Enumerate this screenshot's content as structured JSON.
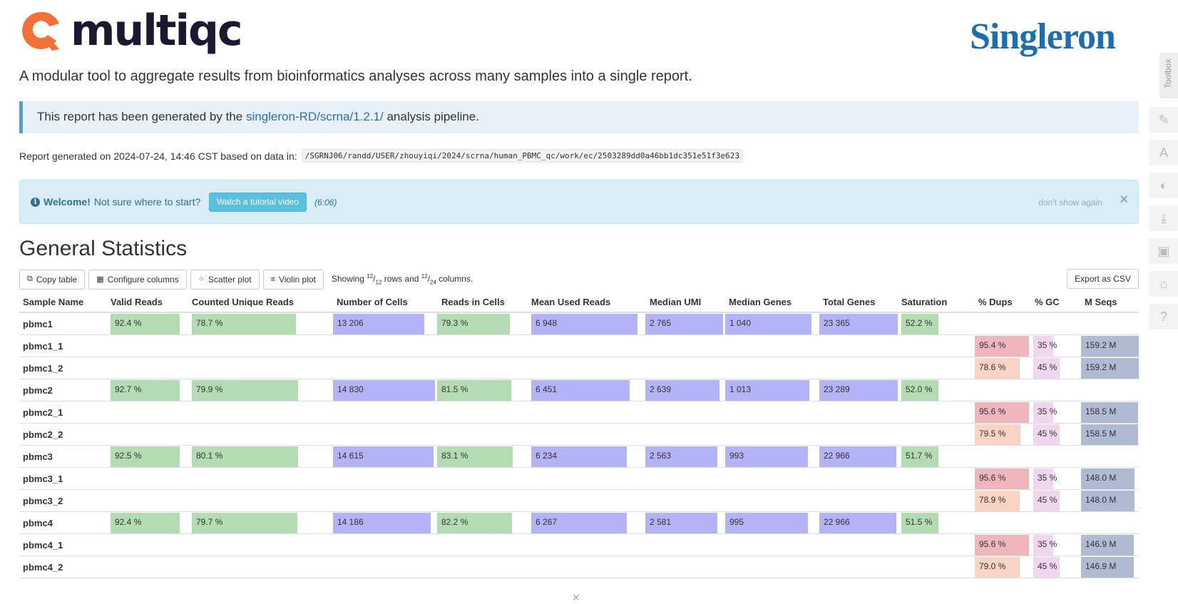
{
  "header": {
    "logo_text": "multiqc",
    "brand_logo": "Singleron",
    "intro": "A modular tool to aggregate results from bioinformatics analyses across many samples into a single report."
  },
  "pipeline": {
    "prefix": "This report has been generated by the ",
    "link": "singleron-RD/scrna/1.2.1/",
    "suffix": " analysis pipeline."
  },
  "report": {
    "generated": "Report generated on 2024-07-24, 14:46 CST based on data in:",
    "path": "/SGRNJ06/randd/USER/zhouyiqi/2024/scrna/human_PBMC_qc/work/ec/2503289dd0a46bb1dc351e51f3e623"
  },
  "welcome": {
    "bold": "Welcome!",
    "text": "Not sure where to start?",
    "button": "Watch a tutorial video",
    "duration": "(6:06)",
    "dont_show": "don't show again",
    "close": "×"
  },
  "general_stats": {
    "title": "General Statistics",
    "buttons": {
      "copy": "Copy table",
      "configure": "Configure columns",
      "scatter": "Scatter plot",
      "violin": "Violin plot",
      "export": "Export as CSV"
    },
    "showing": {
      "pre": "Showing ",
      "rows_num": "12",
      "rows_den": "12",
      "mid": " rows and ",
      "cols_num": "12",
      "cols_den": "24",
      "post": " columns."
    },
    "columns": [
      "Sample Name",
      "Valid Reads",
      "Counted Unique Reads",
      "Number of Cells",
      "Reads in Cells",
      "Mean Used Reads",
      "Median UMI",
      "Median Genes",
      "Total Genes",
      "Saturation",
      "% Dups",
      "% GC",
      "M Seqs"
    ],
    "rows": [
      {
        "name": "pbmc1",
        "valid": "92.4 %",
        "counted": "78.7 %",
        "cells": "13 206",
        "inc": "79.3 %",
        "mean": "6 948",
        "umi": "2 765",
        "genes": "1 040",
        "total": "23 365",
        "sat": "52.2 %",
        "dups": "",
        "gc": "",
        "mseqs": ""
      },
      {
        "name": "pbmc1_1",
        "valid": "",
        "counted": "",
        "cells": "",
        "inc": "",
        "mean": "",
        "umi": "",
        "genes": "",
        "total": "",
        "sat": "",
        "dups": "95.4 %",
        "gc": "35 %",
        "mseqs": "159.2 M"
      },
      {
        "name": "pbmc1_2",
        "valid": "",
        "counted": "",
        "cells": "",
        "inc": "",
        "mean": "",
        "umi": "",
        "genes": "",
        "total": "",
        "sat": "",
        "dups": "78.6 %",
        "gc": "45 %",
        "mseqs": "159.2 M"
      },
      {
        "name": "pbmc2",
        "valid": "92.7 %",
        "counted": "79.9 %",
        "cells": "14 830",
        "inc": "81.5 %",
        "mean": "6 451",
        "umi": "2 639",
        "genes": "1 013",
        "total": "23 289",
        "sat": "52.0 %",
        "dups": "",
        "gc": "",
        "mseqs": ""
      },
      {
        "name": "pbmc2_1",
        "valid": "",
        "counted": "",
        "cells": "",
        "inc": "",
        "mean": "",
        "umi": "",
        "genes": "",
        "total": "",
        "sat": "",
        "dups": "95.6 %",
        "gc": "35 %",
        "mseqs": "158.5 M"
      },
      {
        "name": "pbmc2_2",
        "valid": "",
        "counted": "",
        "cells": "",
        "inc": "",
        "mean": "",
        "umi": "",
        "genes": "",
        "total": "",
        "sat": "",
        "dups": "79.5 %",
        "gc": "45 %",
        "mseqs": "158.5 M"
      },
      {
        "name": "pbmc3",
        "valid": "92.5 %",
        "counted": "80.1 %",
        "cells": "14 615",
        "inc": "83.1 %",
        "mean": "6 234",
        "umi": "2 563",
        "genes": "993",
        "total": "22 966",
        "sat": "51.7 %",
        "dups": "",
        "gc": "",
        "mseqs": ""
      },
      {
        "name": "pbmc3_1",
        "valid": "",
        "counted": "",
        "cells": "",
        "inc": "",
        "mean": "",
        "umi": "",
        "genes": "",
        "total": "",
        "sat": "",
        "dups": "95.6 %",
        "gc": "35 %",
        "mseqs": "148.0 M"
      },
      {
        "name": "pbmc3_2",
        "valid": "",
        "counted": "",
        "cells": "",
        "inc": "",
        "mean": "",
        "umi": "",
        "genes": "",
        "total": "",
        "sat": "",
        "dups": "78.9 %",
        "gc": "45 %",
        "mseqs": "148.0 M"
      },
      {
        "name": "pbmc4",
        "valid": "92.4 %",
        "counted": "79.7 %",
        "cells": "14 186",
        "inc": "82.2 %",
        "mean": "6 267",
        "umi": "2 581",
        "genes": "995",
        "total": "22 966",
        "sat": "51.5 %",
        "dups": "",
        "gc": "",
        "mseqs": ""
      },
      {
        "name": "pbmc4_1",
        "valid": "",
        "counted": "",
        "cells": "",
        "inc": "",
        "mean": "",
        "umi": "",
        "genes": "",
        "total": "",
        "sat": "",
        "dups": "95.6 %",
        "gc": "35 %",
        "mseqs": "146.9 M"
      },
      {
        "name": "pbmc4_2",
        "valid": "",
        "counted": "",
        "cells": "",
        "inc": "",
        "mean": "",
        "umi": "",
        "genes": "",
        "total": "",
        "sat": "",
        "dups": "79.0 %",
        "gc": "45 %",
        "mseqs": "146.9 M"
      }
    ]
  },
  "sidebar": {
    "toolbox": "Toolbox",
    "icons": [
      "pin-icon",
      "font-icon",
      "hide-icon",
      "download-icon",
      "save-icon",
      "graduation-cap-icon",
      "help-icon"
    ]
  },
  "colors": {
    "brand_orange": "#f37137",
    "brand_blue": "#1b6fb0",
    "bar_green": "#b3dcb3",
    "bar_purple": "#b3b3f8",
    "bar_red": "#efb6bd",
    "bar_orange": "#f9d3c3",
    "bar_pink": "#f0d6ee",
    "bar_slate": "#aebbd3"
  }
}
